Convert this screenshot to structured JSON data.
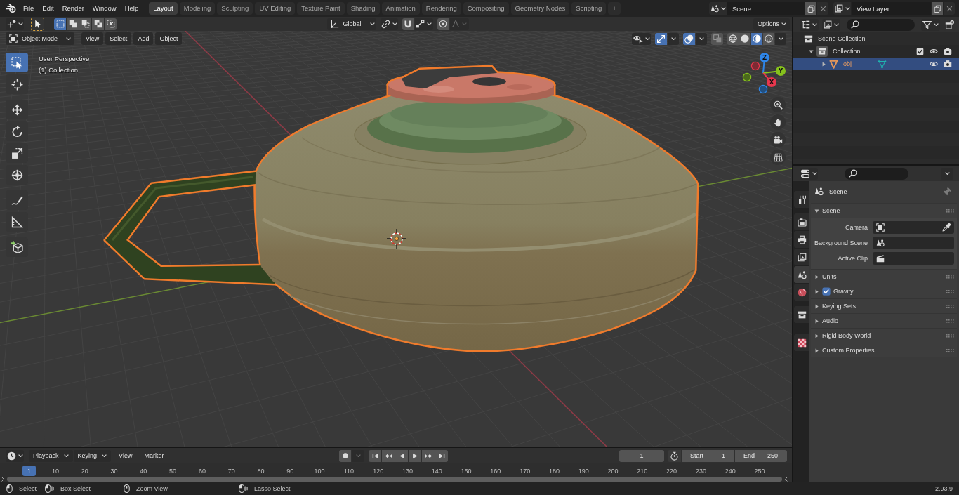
{
  "topbar": {
    "menus": [
      "File",
      "Edit",
      "Render",
      "Window",
      "Help"
    ],
    "workspaces": [
      {
        "label": "Layout",
        "selected": true
      },
      {
        "label": "Modeling",
        "selected": false
      },
      {
        "label": "Sculpting",
        "selected": false
      },
      {
        "label": "UV Editing",
        "selected": false
      },
      {
        "label": "Texture Paint",
        "selected": false
      },
      {
        "label": "Shading",
        "selected": false
      },
      {
        "label": "Animation",
        "selected": false
      },
      {
        "label": "Rendering",
        "selected": false
      },
      {
        "label": "Compositing",
        "selected": false
      },
      {
        "label": "Geometry Nodes",
        "selected": false
      },
      {
        "label": "Scripting",
        "selected": false
      }
    ],
    "add_workspace": "+",
    "scene": {
      "value": "Scene"
    },
    "view_layer": {
      "value": "View Layer"
    }
  },
  "viewport": {
    "tool_settings": {
      "select_modes": [
        {
          "selected": true
        },
        {
          "selected": false
        },
        {
          "selected": false
        },
        {
          "selected": false
        },
        {
          "selected": false
        }
      ],
      "orientation": "Global",
      "snap": false,
      "proportional_editing": false,
      "options": "Options"
    },
    "header": {
      "mode": "Object Mode",
      "menus": [
        "View",
        "Select",
        "Add",
        "Object"
      ],
      "gizmos": true,
      "overlays": true,
      "xray": false,
      "shading": [
        {
          "selected": false
        },
        {
          "selected": false
        },
        {
          "selected": true
        },
        {
          "selected": false
        }
      ]
    },
    "info": [
      "User Perspective",
      "(1) Collection"
    ],
    "tool_groups": [
      {
        "tools": [
          {
            "selected": true
          },
          {
            "selected": false
          }
        ]
      },
      {
        "tools": [
          {
            "selected": false
          },
          {
            "selected": false
          },
          {
            "selected": false
          },
          {
            "selected": false
          }
        ]
      },
      {
        "tools": [
          {
            "selected": false
          },
          {
            "selected": false
          }
        ]
      },
      {
        "tools": [
          {
            "selected": false
          }
        ]
      }
    ],
    "gizmo_axes": [
      {
        "label": "Z"
      },
      {
        "label": "Y"
      },
      {
        "label": "X"
      }
    ]
  },
  "outliner": {
    "tree": [
      {
        "label": "Scene Collection",
        "kind": "scene_collection",
        "selected": false,
        "children": [
          {
            "label": "Collection",
            "kind": "collection",
            "selected": false,
            "expanded": true,
            "checked": true,
            "children": [
              {
                "label": "obj",
                "kind": "object",
                "selected": true,
                "expanded": false
              }
            ]
          }
        ]
      }
    ]
  },
  "properties": {
    "tab_groups": [
      {
        "tabs": [
          {
            "selected": false
          }
        ]
      },
      {
        "tabs": [
          {
            "selected": false
          },
          {
            "selected": false
          },
          {
            "selected": false
          },
          {
            "selected": true
          },
          {
            "selected": false
          }
        ]
      },
      {
        "tabs": [
          {
            "selected": false
          }
        ]
      },
      {
        "tabs": [
          {
            "selected": false
          }
        ]
      }
    ],
    "context": "Scene",
    "panels": [
      {
        "label": "Scene",
        "expanded": true,
        "fields": [
          {
            "label": "Camera"
          },
          {
            "label": "Background Scene"
          },
          {
            "label": "Active Clip"
          }
        ]
      },
      {
        "label": "Units",
        "expanded": false
      },
      {
        "label": "Gravity",
        "expanded": false,
        "toggle": {
          "checked": true
        }
      },
      {
        "label": "Keying Sets",
        "expanded": false
      },
      {
        "label": "Audio",
        "expanded": false
      },
      {
        "label": "Rigid Body World",
        "expanded": false
      },
      {
        "label": "Custom Properties",
        "expanded": false
      }
    ]
  },
  "timeline": {
    "menus": [
      {
        "label": "Playback",
        "kind": "dropdown"
      },
      {
        "label": "Keying",
        "kind": "dropdown"
      },
      {
        "label": "View",
        "kind": "menu"
      },
      {
        "label": "Marker",
        "kind": "menu"
      }
    ],
    "auto_keying": false,
    "current_frame": "1",
    "start": {
      "label": "Start",
      "value": "1"
    },
    "end": {
      "label": "End",
      "value": "250"
    },
    "playhead": "1",
    "ticks": [
      "10",
      "20",
      "30",
      "40",
      "50",
      "60",
      "70",
      "80",
      "90",
      "100",
      "110",
      "120",
      "130",
      "140",
      "150",
      "160",
      "170",
      "180",
      "190",
      "200",
      "210",
      "220",
      "230",
      "240",
      "250"
    ]
  },
  "status_bar": {
    "hints": [
      {
        "label": "Select"
      },
      {
        "label": "Box Select"
      },
      {
        "label": "Zoom View"
      },
      {
        "label": "Lasso Select"
      }
    ],
    "version": "2.93.9"
  }
}
